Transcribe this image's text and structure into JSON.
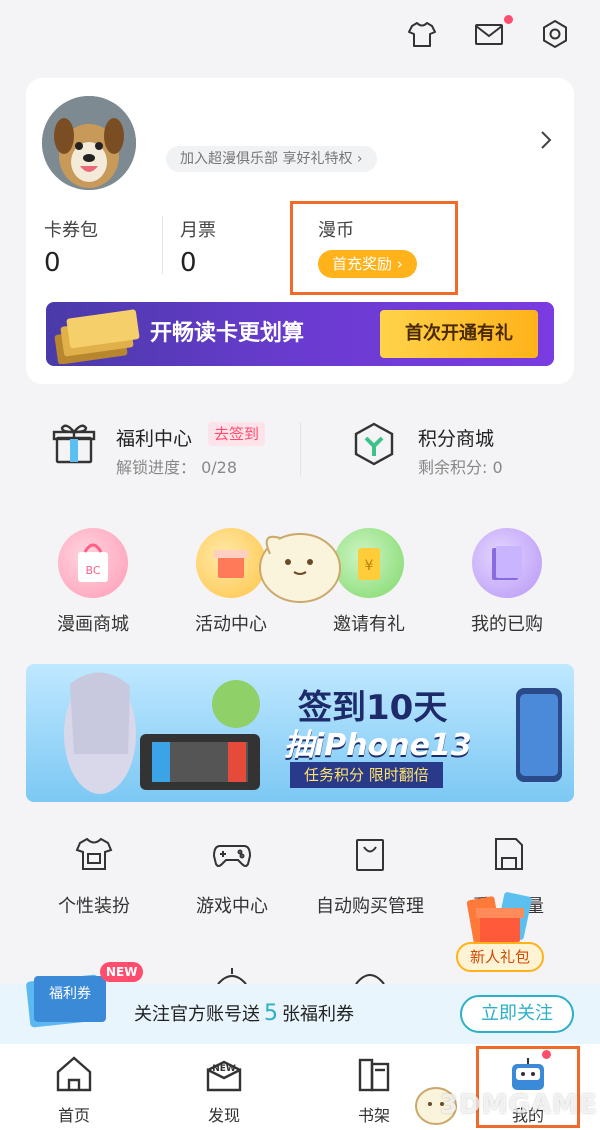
{
  "profile": {
    "club_link": "加入超漫俱乐部 享好礼特权 ›",
    "stats": [
      {
        "label": "卡券包",
        "value": "0"
      },
      {
        "label": "月票",
        "value": "0"
      },
      {
        "label": "漫币",
        "pill": "首充奖励 ›"
      }
    ],
    "promo_banner": {
      "text": "开畅读卡更划算",
      "button": "首次开通有礼"
    }
  },
  "welfare": {
    "title": "福利中心",
    "tag": "去签到",
    "sub": "解锁进度： 0/28"
  },
  "points": {
    "title": "积分商城",
    "sub": "剩余积分: 0"
  },
  "quick_grid": [
    {
      "label": "漫画商城"
    },
    {
      "label": "活动中心"
    },
    {
      "label": "邀请有礼"
    },
    {
      "label": "我的已购"
    }
  ],
  "event_banner": {
    "line1": "签到10天",
    "line2": "抽iPhone13",
    "line3": "任务积分 限时翻倍"
  },
  "tools": [
    {
      "label": "个性装扮"
    },
    {
      "label": "游戏中心"
    },
    {
      "label": "自动购买管理"
    },
    {
      "label": "看…流量"
    }
  ],
  "new_user_pack": "新人礼包",
  "follow": {
    "text_before": "关注官方账号送",
    "number": "5",
    "text_after": "张福利券",
    "button": "立即关注",
    "coupon_label": "福利券",
    "badge": "NEW"
  },
  "tabs": [
    {
      "label": "首页"
    },
    {
      "label": "发现"
    },
    {
      "label": "书架"
    },
    {
      "label": "我的"
    }
  ],
  "watermark": "3DMGAME",
  "colors": {
    "accent": "#ffb21a",
    "highlight": "#f06a2a",
    "teal": "#2bb0c8",
    "pink": "#ff4d6d"
  }
}
